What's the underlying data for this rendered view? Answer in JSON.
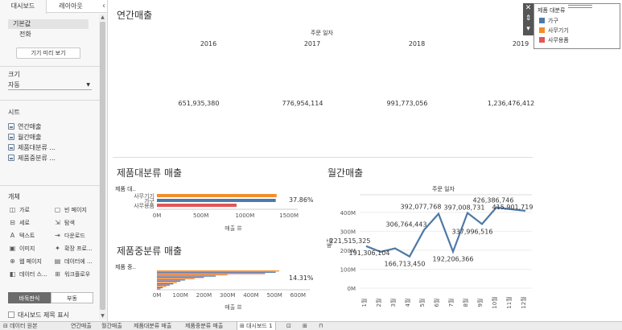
{
  "left_panel": {
    "tabs": [
      "대시보드",
      "레이아웃"
    ],
    "collapse_icon": "chevron-left-icon",
    "device": {
      "items": [
        "기본값",
        "전화"
      ],
      "preview_button": "기기 미리 보기"
    },
    "size": {
      "heading": "크기",
      "value": "자동"
    },
    "sheets": {
      "heading": "시트",
      "items": [
        "연간매출",
        "월간매출",
        "제품대분류 ...",
        "제품중분류 ..."
      ]
    },
    "objects": {
      "heading": "개체",
      "items": [
        {
          "icon": "horizontal-icon",
          "label": "가로"
        },
        {
          "icon": "blank-icon",
          "label": "빈 페이지"
        },
        {
          "icon": "vertical-icon",
          "label": "세로"
        },
        {
          "icon": "navigation-icon",
          "label": "탐색"
        },
        {
          "icon": "text-icon",
          "label": "텍스트"
        },
        {
          "icon": "download-icon",
          "label": "다운로드"
        },
        {
          "icon": "image-icon",
          "label": "이미지"
        },
        {
          "icon": "extension-icon",
          "label": "확장 프로..."
        },
        {
          "icon": "web-page-icon",
          "label": "웹 페이지"
        },
        {
          "icon": "data-story-icon",
          "label": "데이터에 ..."
        },
        {
          "icon": "data-guide-icon",
          "label": "데이터 스..."
        },
        {
          "icon": "workflow-icon",
          "label": "워크플로우"
        }
      ]
    },
    "layout_toggle": {
      "on": "바둑판식",
      "off": "부동"
    },
    "show_title": "대시보드 제목 표시"
  },
  "annual": {
    "title": "연간매출",
    "header": "주문 일자",
    "years": [
      "2016",
      "2017",
      "2018",
      "2019"
    ],
    "values": [
      "651,935,380",
      "776,954,114",
      "991,773,056",
      "1,236,476,412"
    ]
  },
  "category": {
    "title": "제품대분류 매출",
    "row_header": "제품 대..",
    "row_labels": [
      "사무기기",
      "가구",
      "사무용품"
    ],
    "pct_label": "37.86%",
    "x_ticks": [
      "0M",
      "500M",
      "1000M",
      "1500M"
    ],
    "x_title": "매출",
    "chart_data": {
      "type": "bar",
      "categories": [
        "사무기기",
        "가구",
        "사무용품"
      ],
      "values": [
        1360,
        1350,
        905
      ],
      "xlim": [
        0,
        1600
      ],
      "xlabel": "매출"
    }
  },
  "subcategory": {
    "title": "제품중분류 매출",
    "row_header": "제품 중..",
    "pct_label": "14.31%",
    "x_ticks": [
      "0M",
      "100M",
      "200M",
      "300M",
      "400M",
      "500M",
      "600M"
    ],
    "x_title": "매출",
    "chart_data": {
      "type": "bar",
      "values": [
        520,
        505,
        460,
        300,
        250,
        200,
        160,
        120,
        100,
        85,
        70,
        55,
        40,
        25,
        15
      ],
      "xlim": [
        0,
        650
      ],
      "xlabel": "매출"
    }
  },
  "monthly": {
    "title": "월간매출",
    "header": "주문 일자",
    "y_title": "매출",
    "y_ticks": [
      "0M",
      "100M",
      "200M",
      "300M",
      "400M"
    ],
    "x_labels": [
      "1월",
      "2월",
      "3월",
      "4월",
      "5월",
      "6월",
      "7월",
      "8월",
      "9월",
      "10월",
      "11월",
      "12월"
    ],
    "point_labels": [
      "221,515,325",
      "191,306,104",
      "",
      "166,713,450",
      "306,764,443",
      "392,077,768",
      "192,206,366",
      "397,008,731",
      "337,996,516",
      "426,386,746",
      "415,901,719",
      ""
    ],
    "chart_data": {
      "type": "line",
      "x": [
        "1월",
        "2월",
        "3월",
        "4월",
        "5월",
        "6월",
        "7월",
        "8월",
        "9월",
        "10월",
        "11월",
        "12월"
      ],
      "values": [
        221515325,
        191306104,
        210000000,
        166713450,
        306764443,
        392077768,
        192206366,
        397008731,
        337996516,
        426386746,
        415901719,
        408000000
      ],
      "ylim": [
        0,
        450000000
      ],
      "ylabel": "매출"
    }
  },
  "legend": {
    "title": "제품 대분류",
    "items": [
      {
        "label": "가구",
        "color": "#4e79a7"
      },
      {
        "label": "사무기기",
        "color": "#f28e2b"
      },
      {
        "label": "사무용품",
        "color": "#e15759"
      }
    ],
    "controls": [
      "close-icon",
      "pin-icon",
      "more-icon"
    ]
  },
  "tabbar": {
    "datasource": "데이터 원본",
    "tabs": [
      "연간매출",
      "월간매출",
      "제품대분류 매출",
      "제품중분류 매출",
      "대시보드 1"
    ],
    "active": "대시보드 1",
    "new_icons": [
      "new-worksheet-icon",
      "new-dashboard-icon",
      "new-story-icon"
    ]
  },
  "colors": {
    "line": "#4e79a7",
    "furniture": "#4e79a7",
    "office_machine": "#f28e2b",
    "office_supply": "#e15759"
  }
}
